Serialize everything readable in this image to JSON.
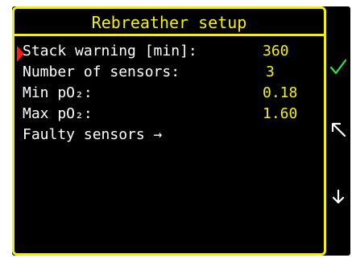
{
  "screen": {
    "title": "Rebreather setup",
    "items": [
      {
        "label": "Stack warning [min]:",
        "value": "360"
      },
      {
        "label": "Number of sensors:",
        "value": "3"
      },
      {
        "label": "Min pO₂:",
        "value": "0.18"
      },
      {
        "label": "Max pO₂:",
        "value": "1.60"
      },
      {
        "label": "Faulty sensors →",
        "value": ""
      }
    ]
  },
  "side_buttons": {
    "confirm_icon": "check-icon",
    "back_icon": "arrow-up-left-icon",
    "next_icon": "arrow-down-icon"
  },
  "colors": {
    "background": "#000000",
    "accent": "#f2ef02",
    "label_text": "#ffffff",
    "value_text": "#f6f200",
    "cursor": "#ff1b1b",
    "confirm": "#30e830"
  }
}
